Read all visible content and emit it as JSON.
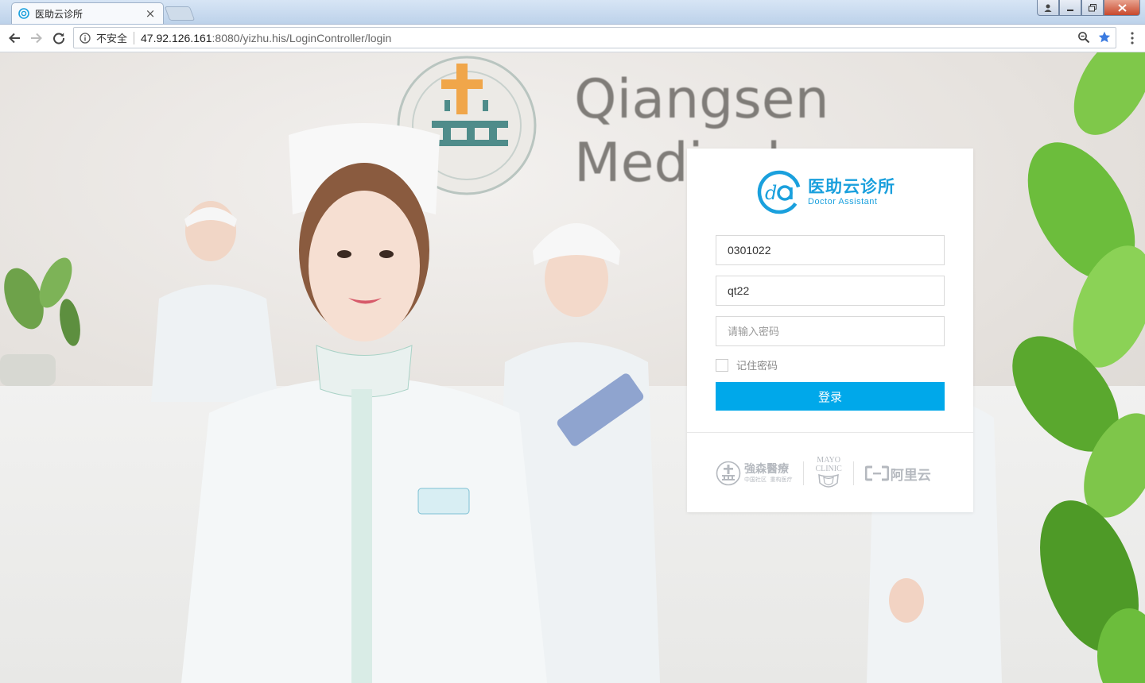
{
  "browser": {
    "tab_title": "医助云诊所",
    "tab_close": "×",
    "security_label": "不安全",
    "url_host": "47.92.126.161",
    "url_rest": ":8080/yizhu.his/LoginController/login"
  },
  "background": {
    "sign_line1": "Qiangsen",
    "sign_line2": "Medical"
  },
  "login": {
    "logo_cn": "医助云诊所",
    "logo_en": "Doctor Assistant",
    "account_value": "0301022",
    "username_value": "qt22",
    "password_placeholder": "请输入密码",
    "remember_label": "记住密码",
    "submit_label": "登录"
  },
  "partners": {
    "qiangsen_name": "強森醫療",
    "qiangsen_tagline": "中国社区  重构医疗",
    "mayo_line1": "MAYO",
    "mayo_line2": "CLINIC",
    "aliyun_name": "阿里云"
  },
  "colors": {
    "brand": "#1aa0dd",
    "button": "#00a8ea"
  }
}
